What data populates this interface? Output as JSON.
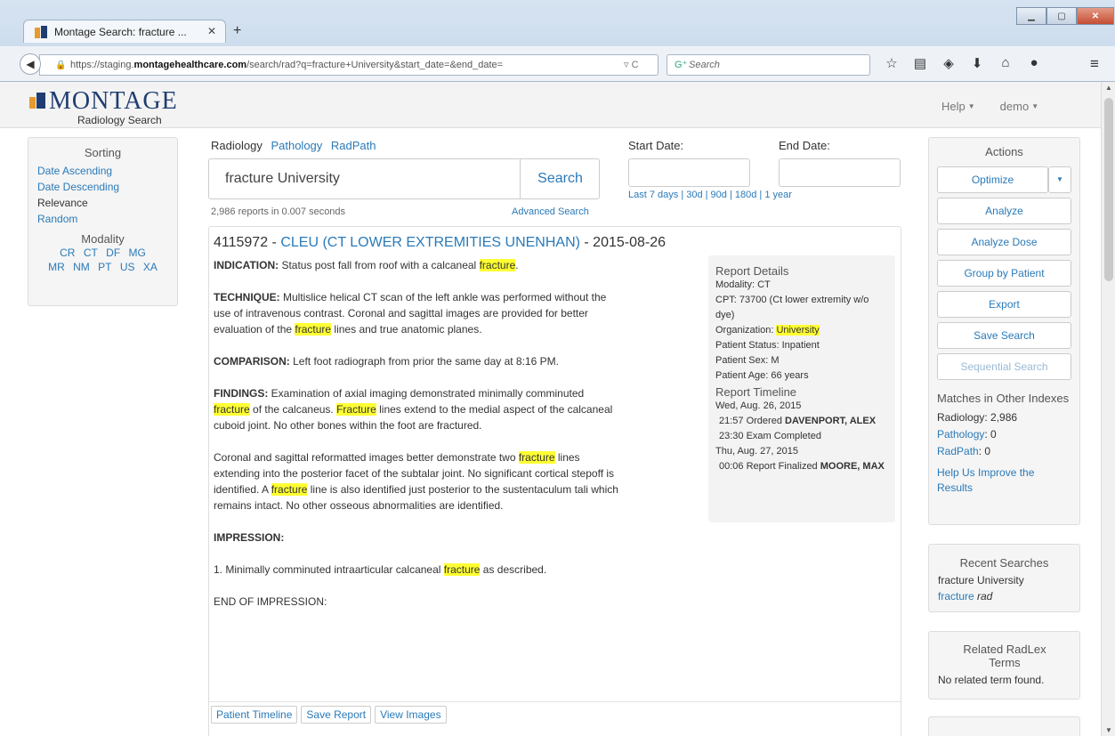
{
  "browser": {
    "tab_title": "Montage Search: fracture ...",
    "url_prefix": "https://staging.",
    "url_host": "montagehealthcare.com",
    "url_path": "/search/rad?q=fracture+University&start_date=&end_date=",
    "search_placeholder": "Search"
  },
  "header": {
    "logo_word": "MONTAGE",
    "logo_sub": "Radiology Search",
    "help_label": "Help",
    "user_label": "demo"
  },
  "sorting": {
    "title": "Sorting",
    "items": [
      "Date Ascending",
      "Date Descending",
      "Relevance",
      "Random"
    ],
    "modality_title": "Modality",
    "modalities": [
      "CR",
      "CT",
      "DF",
      "MG",
      "MR",
      "NM",
      "PT",
      "US",
      "XA"
    ]
  },
  "search": {
    "types": [
      "Radiology",
      "Pathology",
      "RadPath"
    ],
    "query": "fracture University",
    "button": "Search",
    "meta": "2,986 reports in 0.007 seconds",
    "advanced": "Advanced Search",
    "start_label": "Start Date:",
    "end_label": "End Date:",
    "quick_ranges": "Last 7 days | 30d | 90d | 180d | 1 year"
  },
  "report": {
    "id": "4115972",
    "modality_code": "CLEU (CT LOWER EXTREMITIES UNENHAN)",
    "date": "2015-08-26",
    "indication_label": "INDICATION:",
    "indication_text": " Status post fall from roof with a calcaneal ",
    "technique_label": "TECHNIQUE:",
    "technique_text_1": " Multislice helical CT scan of the left ankle was performed without the use of intravenous contrast. Coronal and sagittal images are provided for better evaluation of the ",
    "technique_text_2": " lines and true anatomic planes.",
    "comparison_label": "COMPARISON:",
    "comparison_text": " Left foot radiograph from prior the same day at 8:16 PM.",
    "findings_label": "FINDINGS:",
    "findings_text_1": " Examination of axial imaging demonstrated minimally comminuted ",
    "findings_text_2": " of the calcaneus. ",
    "findings_text_3": " lines extend to the medial aspect of the calcaneal cuboid joint. No other bones within the foot are fractured.",
    "para2_text_1": "Coronal and sagittal reformatted images better demonstrate two ",
    "para2_text_2": " lines extending into the posterior facet of the subtalar joint. No significant cortical stepoff is identified. A ",
    "para2_text_3": " line is also identified just posterior to the sustentaculum tali which remains intact. No other osseous abnormalities are identified.",
    "impression_label": "IMPRESSION:",
    "impression_text_1": "1. Minimally comminuted intraarticular calcaneal ",
    "impression_text_2": " as described.",
    "end_text": "END OF IMPRESSION:",
    "hl_lower": "fracture",
    "hl_upper": "Fracture",
    "buttons": [
      "Patient Timeline",
      "Save Report",
      "View Images"
    ],
    "details": {
      "title": "Report Details",
      "modality": "Modality: CT",
      "cpt": "CPT: 73700 (Ct lower extremity w/o dye)",
      "org_label": "Organization: ",
      "org_value": "University",
      "status": "Patient Status: Inpatient",
      "sex": "Patient Sex: M",
      "age": "Patient Age: 66 years",
      "timeline_title": "Report Timeline",
      "day1": "Wed, Aug. 26, 2015",
      "ev1_text": "21:57 Ordered ",
      "ev1_name": "DAVENPORT, ALEX",
      "ev2_text": "23:30 Exam Completed",
      "day2": "Thu, Aug. 27, 2015",
      "ev3_text": "00:06 Report Finalized ",
      "ev3_name": "MOORE, MAX"
    }
  },
  "actions": {
    "title": "Actions",
    "optimize": "Optimize",
    "analyze": "Analyze",
    "analyze_dose": "Analyze Dose",
    "group_by_patient": "Group by Patient",
    "export": "Export",
    "save_search": "Save Search",
    "sequential_search": "Sequential Search",
    "matches_title": "Matches in Other Indexes",
    "radiology": "Radiology: 2,986",
    "pathology_label": "Pathology",
    "pathology_count": ": 0",
    "radpath_label": "RadPath",
    "radpath_count": ": 0",
    "help_improve": "Help Us Improve the Results"
  },
  "recent": {
    "title": "Recent Searches",
    "item1": "fracture University",
    "item2_term": "fracture ",
    "item2_type": "rad"
  },
  "related": {
    "title": "Related RadLex Terms",
    "empty": "No related term found."
  },
  "colors": {
    "link": "#2a7ab8",
    "highlight": "#ffff33",
    "logo_blue": "#1f3d70"
  }
}
